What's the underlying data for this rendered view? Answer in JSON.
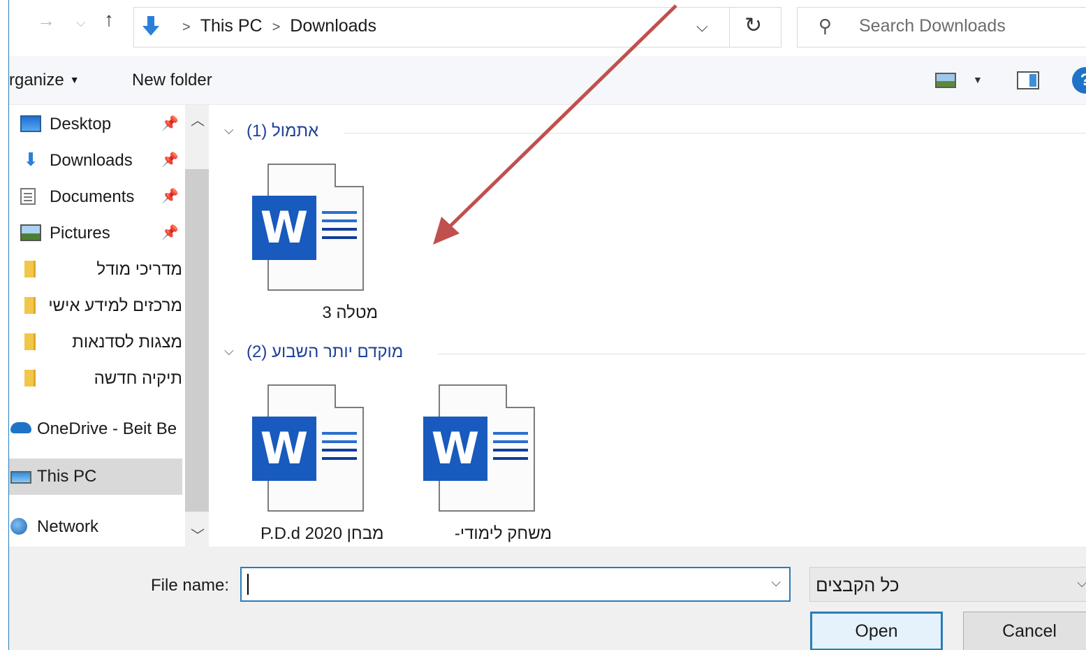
{
  "address": {
    "crumbs": [
      "This PC",
      "Downloads"
    ],
    "search_placeholder": "Search Downloads"
  },
  "toolbar": {
    "organize_label": "rganize",
    "new_folder_label": "New folder",
    "help_glyph": "?"
  },
  "nav": {
    "items": [
      {
        "label": "Desktop",
        "icon": "desktop-icon",
        "pinned": true
      },
      {
        "label": "Downloads",
        "icon": "downloads-icon",
        "pinned": true
      },
      {
        "label": "Documents",
        "icon": "documents-icon",
        "pinned": true
      },
      {
        "label": "Pictures",
        "icon": "pictures-icon",
        "pinned": true
      },
      {
        "label": "מדריכי מודל",
        "icon": "folder-icon"
      },
      {
        "label": "מרכזים למידע אישי",
        "icon": "folder-icon"
      },
      {
        "label": "מצגות לסדנאות",
        "icon": "folder-icon"
      },
      {
        "label": "תיקיה חדשה",
        "icon": "folder-icon"
      },
      {
        "label": "OneDrive - Beit Be",
        "icon": "onedrive-icon"
      },
      {
        "label": "This PC",
        "icon": "this-pc-icon",
        "selected": true
      },
      {
        "label": "Network",
        "icon": "network-icon"
      }
    ]
  },
  "groups": [
    {
      "label": "(1) אתמול",
      "files": [
        "מטלה 3"
      ]
    },
    {
      "label": "(2) מוקדם יותר השבוע",
      "files": [
        "מבחן P.D.d 2020",
        "משחק לימודי-"
      ]
    }
  ],
  "footer": {
    "file_name_label": "File name:",
    "file_name_value": "",
    "file_type_value": "כל הקבצים",
    "open_label": "Open",
    "cancel_label": "Cancel"
  },
  "colors": {
    "accent": "#2a7db8",
    "group_header": "#1e3f96",
    "word_blue": "#185abd",
    "annotation_arrow": "#c0504d"
  }
}
